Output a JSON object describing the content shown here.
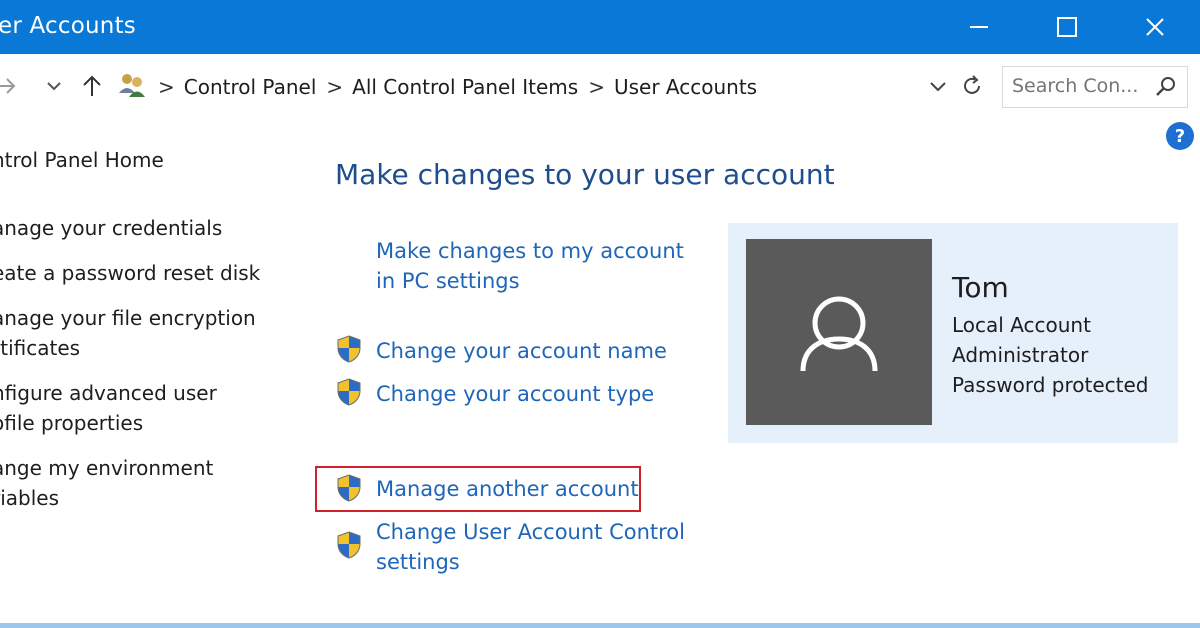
{
  "window": {
    "title": "er Accounts",
    "controls": {
      "minimize": "minimize-icon",
      "maximize": "maximize-icon",
      "close": "close-icon"
    }
  },
  "address_bar": {
    "crumbs": [
      "Control Panel",
      "All Control Panel Items",
      "User Accounts"
    ],
    "separator": ">",
    "search_placeholder": "Search Con..."
  },
  "sidebar": {
    "items": [
      {
        "lines": [
          "ntrol Panel Home"
        ]
      },
      {
        "lines": [
          "anage your credentials"
        ]
      },
      {
        "lines": [
          "eate a password reset disk"
        ]
      },
      {
        "lines": [
          "anage your file encryption",
          "rtificates"
        ]
      },
      {
        "lines": [
          "nfigure advanced user",
          "ofile properties"
        ]
      },
      {
        "lines": [
          "ange my environment",
          "riables"
        ]
      }
    ]
  },
  "main": {
    "heading": "Make changes to your user account",
    "tasks": [
      {
        "lines": [
          "Make changes to my account",
          "in PC settings"
        ],
        "shield": false
      },
      {
        "lines": [
          "Change your account name"
        ],
        "shield": true
      },
      {
        "lines": [
          "Change your account type"
        ],
        "shield": true
      },
      {
        "lines": [
          "Manage another account"
        ],
        "shield": true,
        "highlighted": true
      },
      {
        "lines": [
          "Change User Account Control",
          "settings"
        ],
        "shield": true
      }
    ]
  },
  "user": {
    "name": "Tom",
    "details": [
      "Local Account",
      "Administrator",
      "Password protected"
    ],
    "avatar_icon": "user-silhouette-icon"
  },
  "help_label": "?",
  "colors": {
    "titlebar": "#0a78d7",
    "link": "#1f66b8",
    "heading": "#1f4e8c",
    "highlight_border": "#d0202a",
    "user_card_bg": "#e6f0fb",
    "avatar_bg": "#5a5a5a"
  }
}
